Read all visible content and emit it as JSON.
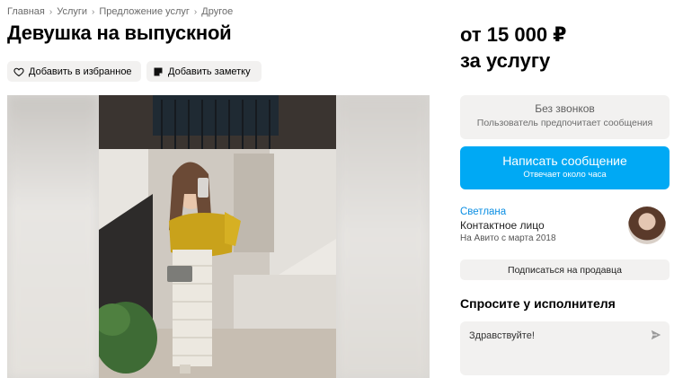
{
  "breadcrumb": {
    "items": [
      "Главная",
      "Услуги",
      "Предложение услуг",
      "Другое"
    ],
    "separator": "›"
  },
  "listing": {
    "title": "Девушка на выпускной"
  },
  "actions": {
    "favorite_label": "Добавить в избранное",
    "note_label": "Добавить заметку"
  },
  "price": {
    "line1": "от 15 000 ₽",
    "line2": "за услугу"
  },
  "contact": {
    "no_calls_title": "Без звонков",
    "no_calls_sub": "Пользователь предпочитает сообщения",
    "write_label": "Написать сообщение",
    "write_sub": "Отвечает около часа"
  },
  "seller": {
    "name": "Светлана",
    "role": "Контактное лицо",
    "since": "На Авито с марта 2018",
    "subscribe_label": "Подписаться на продавца"
  },
  "ask": {
    "title": "Спросите у исполнителя",
    "message": "Здравствуйте!"
  },
  "colors": {
    "accent": "#00a9f4",
    "link": "#0a8ee3",
    "chip_bg": "#f2f1f0"
  },
  "icons": {
    "favorite": "heart-icon",
    "note": "note-icon",
    "send": "send-icon"
  }
}
